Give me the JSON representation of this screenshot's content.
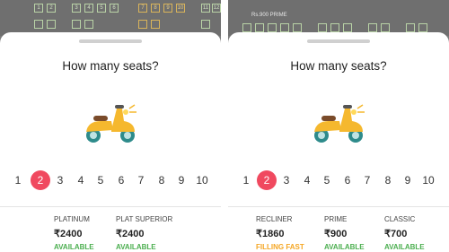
{
  "left": {
    "bg_seats": [
      {
        "label": "1",
        "tone": "green"
      },
      {
        "label": "2",
        "tone": "green"
      },
      {
        "label": "3",
        "tone": "green"
      },
      {
        "label": "4",
        "tone": "green"
      },
      {
        "label": "5",
        "tone": "green"
      },
      {
        "label": "6",
        "tone": "green"
      },
      {
        "label": "7",
        "tone": "gold"
      },
      {
        "label": "8",
        "tone": "gold"
      },
      {
        "label": "9",
        "tone": "gold"
      },
      {
        "label": "10",
        "tone": "gold"
      },
      {
        "label": "11",
        "tone": "green"
      },
      {
        "label": "12",
        "tone": "green"
      }
    ],
    "title": "How many seats?",
    "numbers": [
      "1",
      "2",
      "3",
      "4",
      "5",
      "6",
      "7",
      "8",
      "9",
      "10"
    ],
    "selected": "2",
    "categories": [
      {
        "name": "PLATINUM",
        "price": "₹2400",
        "status": "AVAILABLE",
        "tone": "available"
      },
      {
        "name": "PLAT SUPERIOR",
        "price": "₹2400",
        "status": "AVAILABLE",
        "tone": "available"
      }
    ]
  },
  "right": {
    "bg_label": "Rs.900  PRIME",
    "title": "How many seats?",
    "numbers": [
      "1",
      "2",
      "3",
      "4",
      "5",
      "6",
      "7",
      "8",
      "9",
      "10"
    ],
    "selected": "2",
    "categories": [
      {
        "name": "RECLINER",
        "price": "₹1860",
        "status": "FILLING FAST",
        "tone": "filling"
      },
      {
        "name": "PRIME",
        "price": "₹900",
        "status": "AVAILABLE",
        "tone": "available"
      },
      {
        "name": "CLASSIC",
        "price": "₹700",
        "status": "AVAILABLE",
        "tone": "available"
      }
    ]
  },
  "colors": {
    "selected": "#f0495f",
    "available": "#4caf50",
    "filling": "#f5a623"
  },
  "icons": {
    "scooter": "scooter-icon"
  }
}
